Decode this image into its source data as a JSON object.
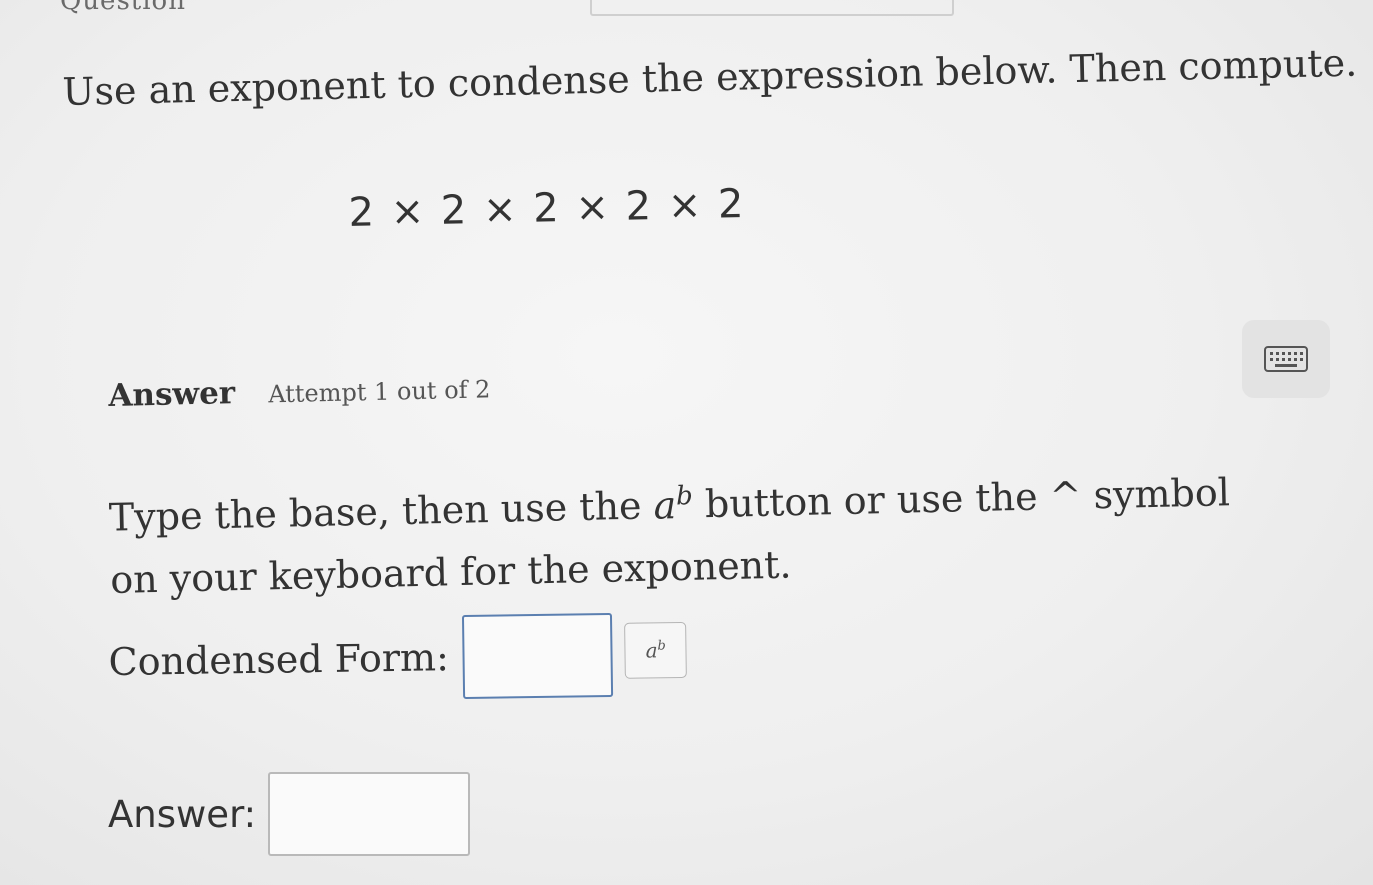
{
  "header": {
    "section_fragment": "Question"
  },
  "question": {
    "prompt": "Use an exponent to condense the expression below. Then compute.",
    "expression": "2 × 2 × 2 × 2 × 2"
  },
  "answer_section": {
    "title": "Answer",
    "attempt": "Attempt 1 out of 2",
    "keyboard_icon": "keyboard-icon"
  },
  "instructions": {
    "part1": "Type the base, then use the",
    "ab_base": "a",
    "ab_exp": "b",
    "part2": "button or use the ^ symbol on your keyboard for the exponent."
  },
  "condensed": {
    "label": "Condensed Form:",
    "value": "",
    "exponent_button_base": "a",
    "exponent_button_exp": "b"
  },
  "answer": {
    "label": "Answer:",
    "value": ""
  },
  "colors": {
    "focused_border": "#5b7fb0",
    "background": "#efefef",
    "text": "#333333"
  }
}
